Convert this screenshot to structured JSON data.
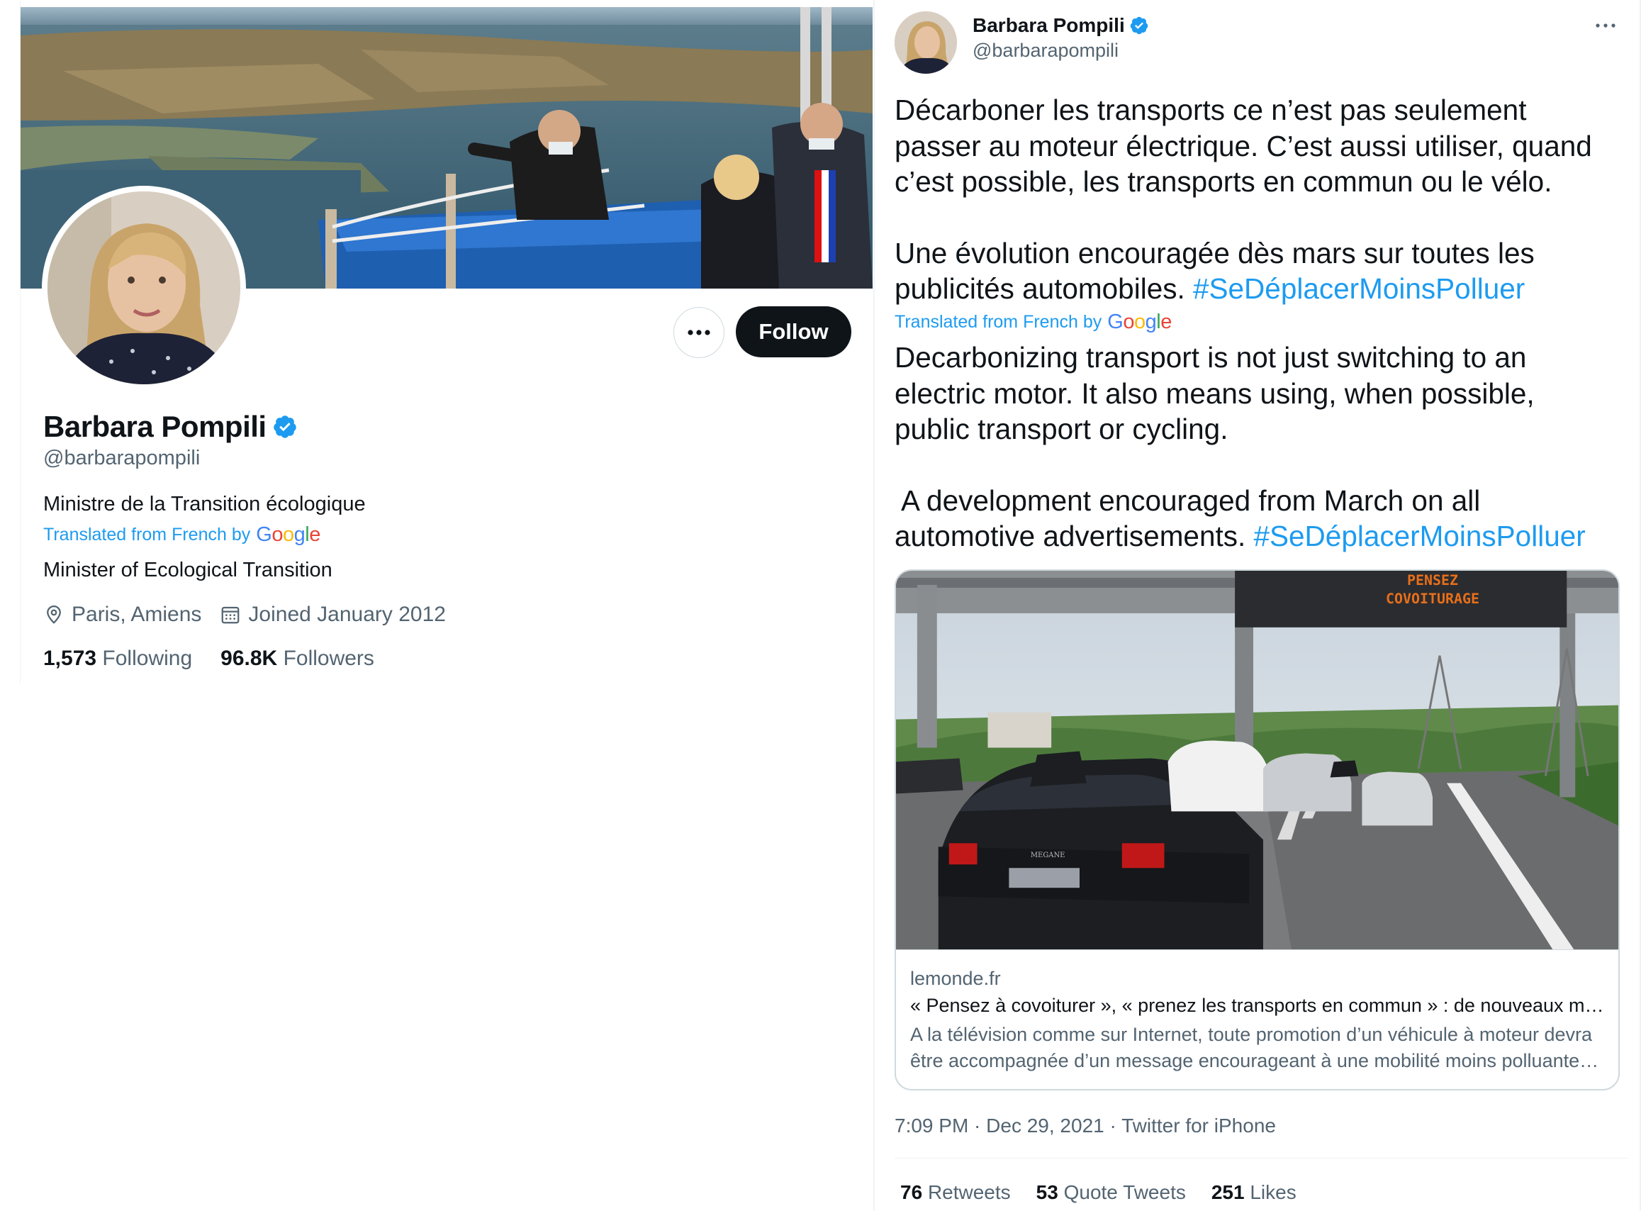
{
  "profile": {
    "name": "Barbara Pompili",
    "handle": "@barbarapompili",
    "bio": "Ministre de la Transition écologique",
    "translated_prefix": "Translated from French by",
    "translated_brand": "Google",
    "bio_translated": "Minister of Ecological Transition",
    "location": "Paris, Amiens",
    "joined": "Joined January 2012",
    "following_count": "1,573",
    "following_label": "Following",
    "followers_count": "96.8K",
    "followers_label": "Followers",
    "follow_label": "Follow",
    "more_icon": "ellipsis-icon",
    "location_icon": "location-pin-icon",
    "calendar_icon": "calendar-icon",
    "verified_icon": "verified-badge-icon"
  },
  "tweet": {
    "author_name": "Barbara Pompili",
    "author_handle": "@barbarapompili",
    "text_lines": [
      "Décarboner les transports ce n’est pas seulement",
      "passer au moteur électrique. C’est aussi utiliser, quand",
      "c’est possible, les transports en commun ou le vélo."
    ],
    "text_lines_2": [
      "Une évolution encouragée dès mars sur toutes les",
      "publicités automobiles. "
    ],
    "hashtag": "#SeDéplacerMoinsPolluer",
    "translated_prefix": "Translated from French by",
    "translated_brand": "Google",
    "translation_lines": [
      "Decarbonizing transport is not just switching to an",
      "electric motor. It also means using, when possible,",
      "public transport or cycling."
    ],
    "translation_lines_2": [
      " A development encouraged from March on all",
      "automotive advertisements. "
    ],
    "card": {
      "domain": "lemonde.fr",
      "title": "« Pensez à covoiturer », « prenez les transports en commun » : de nouveaux messages obligatoires",
      "description": "A la télévision comme sur Internet, toute promotion d’un véhicule à moteur devra être accompagnée d’un message encourageant à une mobilité moins polluante dans les publicités automobiles.",
      "sign_line1": "PENSEZ",
      "sign_line2": "COVOITURAGE",
      "car_badge": "MEGANE"
    },
    "time": "7:09 PM · Dec 29, 2021 · Twitter for iPhone",
    "retweets_count": "76",
    "retweets_label": "Retweets",
    "quotes_count": "53",
    "quotes_label": "Quote Tweets",
    "likes_count": "251",
    "likes_label": "Likes"
  },
  "colors": {
    "accent": "#1d9bf0",
    "text_primary": "#0f1419",
    "text_secondary": "#536471",
    "button_dark": "#0f1419",
    "border": "#cfd9de"
  }
}
